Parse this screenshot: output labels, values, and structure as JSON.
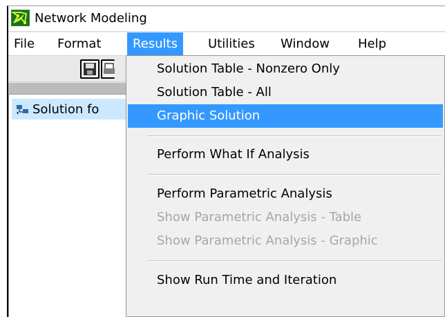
{
  "window": {
    "title": "Network Modeling",
    "app_icon": "network-modeling-app-icon"
  },
  "menubar": {
    "items": [
      {
        "label": "File"
      },
      {
        "label": "Format"
      },
      {
        "label": "Results",
        "active": true
      },
      {
        "label": "Utilities"
      },
      {
        "label": "Window"
      },
      {
        "label": "Help"
      }
    ]
  },
  "toolbar": {
    "buttons": [
      {
        "icon": "save-icon"
      },
      {
        "icon": "print-icon"
      }
    ]
  },
  "child_window": {
    "tree_item_label": "Solution fo",
    "tree_item_icon": "network-icon"
  },
  "results_menu": {
    "items": [
      {
        "label": "Solution Table - Nonzero Only",
        "enabled": true
      },
      {
        "label": "Solution Table - All",
        "enabled": true
      },
      {
        "label": "Graphic Solution",
        "enabled": true,
        "highlighted": true
      },
      {
        "label": "Perform What If Analysis",
        "enabled": true
      },
      {
        "label": "Perform Parametric Analysis",
        "enabled": true
      },
      {
        "label": "Show Parametric Analysis - Table",
        "enabled": false
      },
      {
        "label": "Show Parametric Analysis - Graphic",
        "enabled": false
      },
      {
        "label": "Show Run Time and Iteration",
        "enabled": true
      }
    ]
  },
  "colors": {
    "highlight": "#3399ff",
    "tree_selection": "#cce8ff",
    "disabled_text": "#a6a6a6"
  }
}
